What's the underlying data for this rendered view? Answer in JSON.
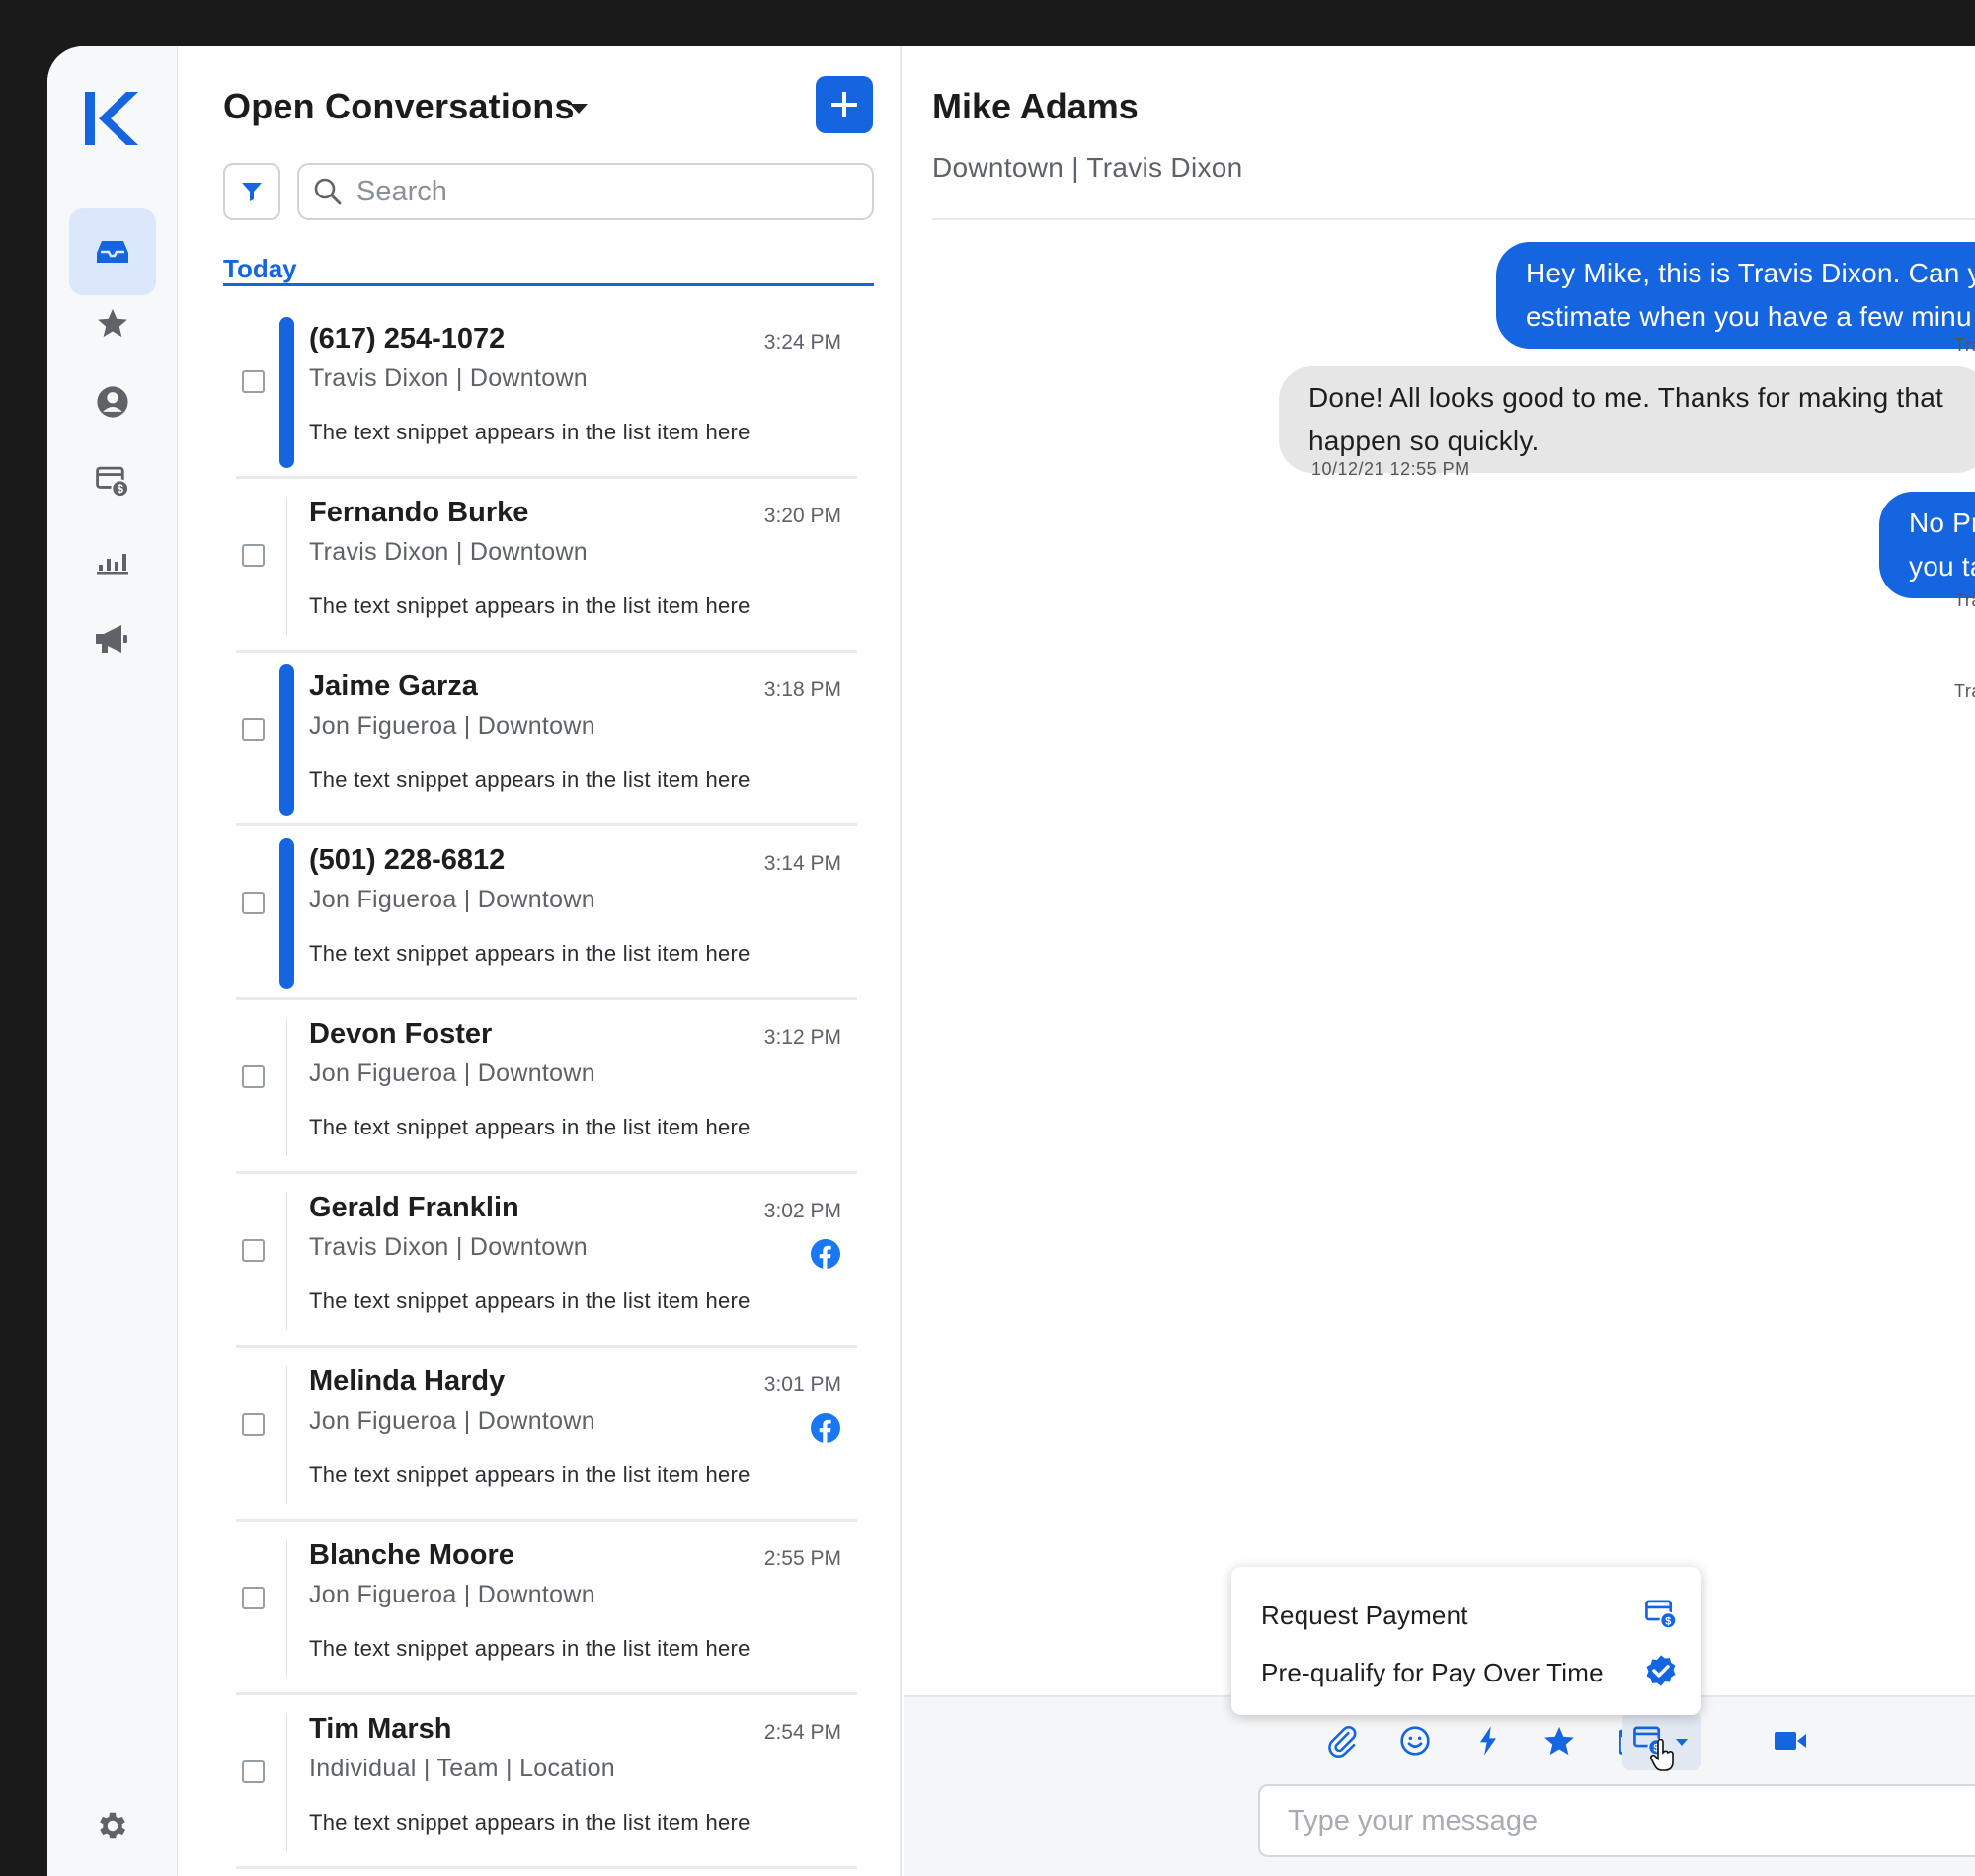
{
  "list": {
    "title": "Open Conversations",
    "search_placeholder": "Search",
    "section": "Today",
    "items": [
      {
        "name": "(617) 254-1072",
        "time": "3:24 PM",
        "sub": "Travis Dixon | Downtown",
        "snippet": "The text snippet appears in the list item here",
        "unread": true,
        "facebook": false
      },
      {
        "name": "Fernando Burke",
        "time": "3:20 PM",
        "sub": "Travis Dixon | Downtown",
        "snippet": "The text snippet appears in the list item here",
        "unread": false,
        "facebook": false
      },
      {
        "name": "Jaime Garza",
        "time": "3:18 PM",
        "sub": "Jon Figueroa | Downtown",
        "snippet": "The text snippet appears in the list item here",
        "unread": true,
        "facebook": false
      },
      {
        "name": "(501) 228-6812",
        "time": "3:14 PM",
        "sub": "Jon Figueroa | Downtown",
        "snippet": "The text snippet appears in the list item here",
        "unread": true,
        "facebook": false
      },
      {
        "name": "Devon Foster",
        "time": "3:12 PM",
        "sub": "Jon Figueroa | Downtown",
        "snippet": "The text snippet appears in the list item here",
        "unread": false,
        "facebook": false
      },
      {
        "name": "Gerald Franklin",
        "time": "3:02 PM",
        "sub": "Travis Dixon | Downtown",
        "snippet": "The text snippet appears in the list item here",
        "unread": false,
        "facebook": true
      },
      {
        "name": "Melinda Hardy",
        "time": "3:01 PM",
        "sub": "Jon Figueroa | Downtown",
        "snippet": "The text snippet appears in the list item here",
        "unread": false,
        "facebook": true
      },
      {
        "name": "Blanche Moore",
        "time": "2:55 PM",
        "sub": "Jon Figueroa | Downtown",
        "snippet": "The text snippet appears in the list item here",
        "unread": false,
        "facebook": false
      },
      {
        "name": "Tim Marsh",
        "time": "2:54 PM",
        "sub": "Individual | Team | Location",
        "snippet": "The text snippet appears in the list item here",
        "unread": false,
        "facebook": false
      }
    ]
  },
  "chat": {
    "contact_name": "Mike Adams",
    "contact_sub": "Downtown | Travis Dixon",
    "messages": [
      {
        "direction": "out",
        "lines": [
          "Hey Mike, this is Travis Dixon. Can y",
          "estimate when you have a few minu"
        ],
        "meta": "Tra"
      },
      {
        "direction": "in",
        "lines": [
          "Done! All looks good to me. Thanks for making that",
          "happen so quickly."
        ],
        "meta": "10/12/21 12:55 PM"
      },
      {
        "direction": "out",
        "lines": [
          "No Probl",
          "you taker"
        ],
        "meta": "Tra"
      },
      {
        "direction": "out",
        "lines": [],
        "meta": "Tra"
      }
    ],
    "popup": {
      "request_payment": "Request Payment",
      "prequalify": "Pre-qualify for Pay Over Time"
    },
    "composer_placeholder": "Type your message"
  },
  "colors": {
    "accent": "#1565e0",
    "rail_active": "#dbe8fb",
    "incoming_bubble": "#e6e6e6",
    "facebook": "#1877f2"
  }
}
